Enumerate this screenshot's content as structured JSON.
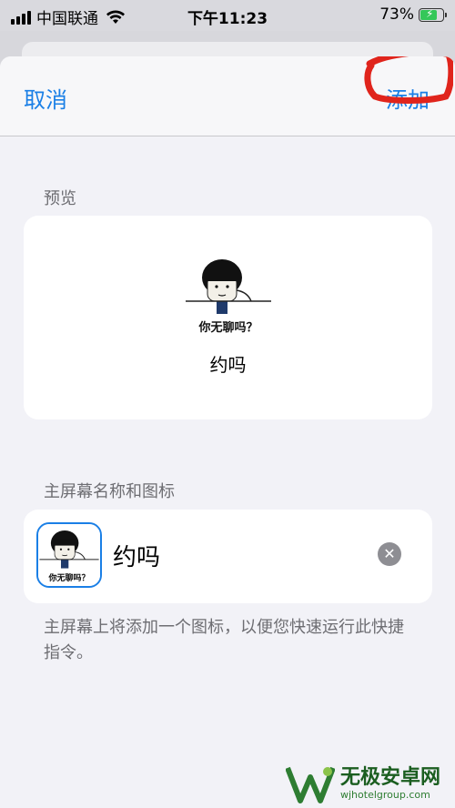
{
  "status_bar": {
    "carrier": "中国联通",
    "time": "下午11:23",
    "battery_percent": "73%",
    "battery_level": 0.73
  },
  "nav": {
    "cancel_label": "取消",
    "add_label": "添加"
  },
  "preview": {
    "section_label": "预览",
    "icon_caption": "你无聊吗？",
    "app_name": "约吗"
  },
  "home_screen": {
    "section_label": "主屏幕名称和图标",
    "icon_caption": "你无聊吗？",
    "name_value": "约吗",
    "footnote": "主屏幕上将添加一个图标，以便您快速运行此快捷指令。"
  },
  "watermark": {
    "title": "无极安卓网",
    "subtitle": "wjhotelgroup.com"
  },
  "colors": {
    "accent": "#1a7fe6",
    "annotation": "#e0241c",
    "battery": "#34c759"
  }
}
